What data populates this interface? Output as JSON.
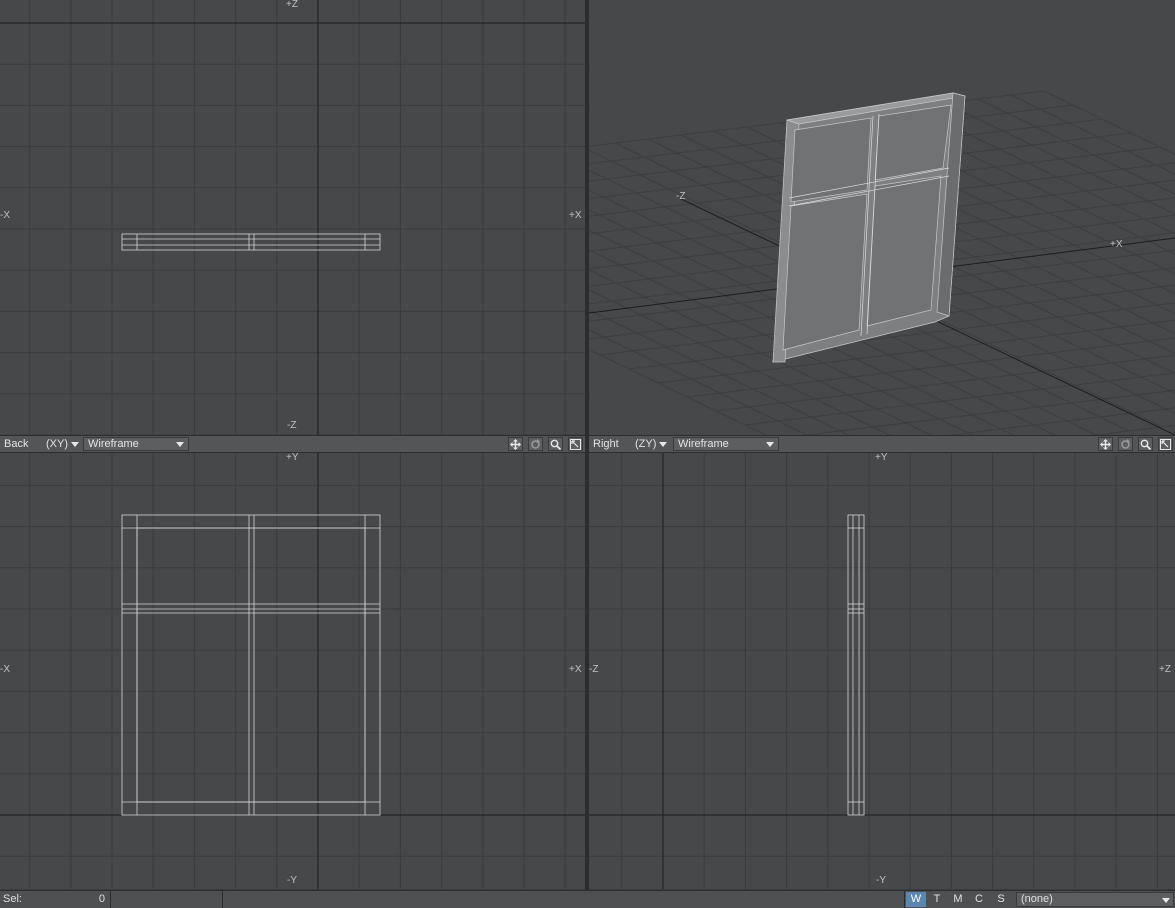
{
  "viewports": {
    "top": {
      "axis_top": "+Z",
      "axis_bottom": "-Z",
      "axis_left": "-X",
      "axis_right": "+X"
    },
    "perspective": {
      "axis_z": "-Z",
      "axis_x": "+X"
    },
    "back": {
      "name": "Back",
      "plane": "(XY)",
      "mode": "Wireframe",
      "axis_top": "+Y",
      "axis_bottom": "-Y",
      "axis_left": "-X",
      "axis_right": "+X"
    },
    "right": {
      "name": "Right",
      "plane": "(ZY)",
      "mode": "Wireframe",
      "axis_top": "+Y",
      "axis_bottom": "-Y",
      "axis_left": "-Z",
      "axis_right": "+Z"
    }
  },
  "header_icons": [
    "move-view-icon",
    "rotate-view-icon",
    "zoom-view-icon",
    "maximize-view-icon"
  ],
  "status_bar": {
    "sel_label": "Sel:",
    "sel_count": "0",
    "modes": [
      {
        "label": "W",
        "active": true
      },
      {
        "label": "T",
        "active": false
      },
      {
        "label": "M",
        "active": false
      },
      {
        "label": "C",
        "active": false
      },
      {
        "label": "S",
        "active": false
      }
    ],
    "selection_set": "(none)"
  },
  "colors": {
    "viewport_bg": "#46484a",
    "grid": "#3a3c3e",
    "axis": "#1c1d1e",
    "wire": "#d6d6d6",
    "active_mode": "#5a86b0"
  }
}
